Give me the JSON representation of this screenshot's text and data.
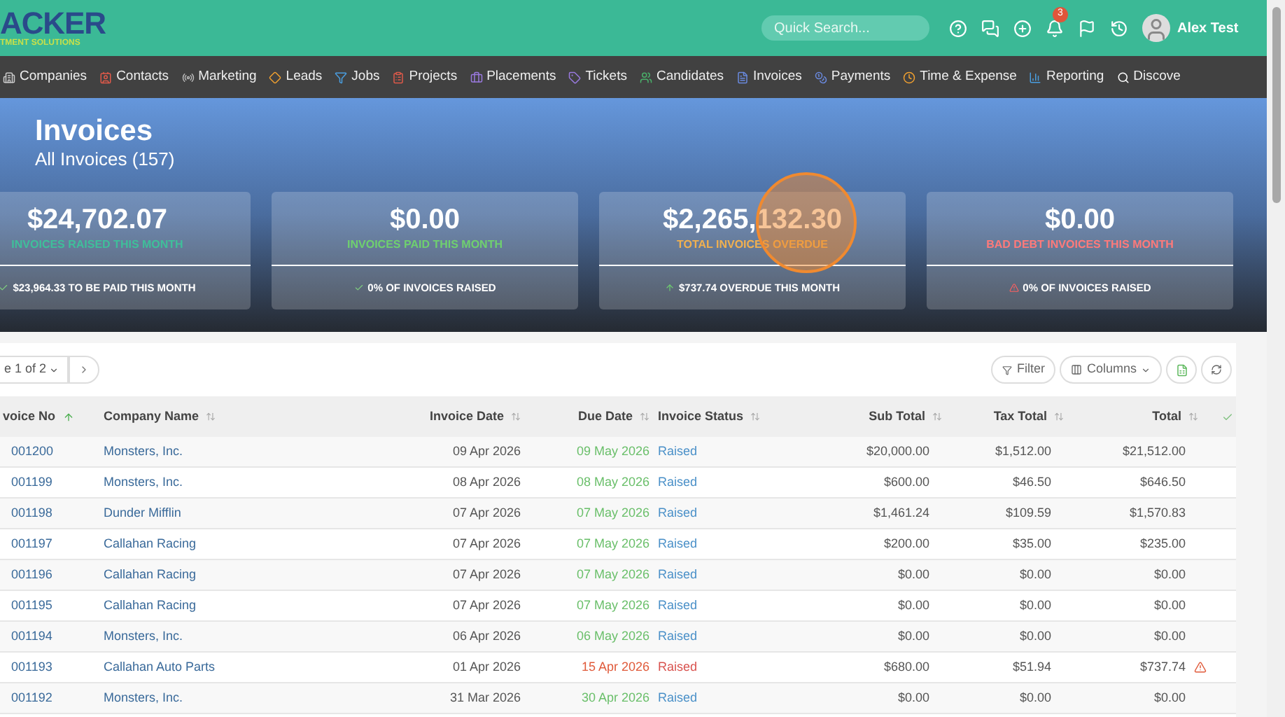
{
  "brand": {
    "name": "ACKER",
    "tagline": "TMENT SOLUTIONS"
  },
  "search": {
    "placeholder": "Quick Search..."
  },
  "notifications": {
    "count": "3"
  },
  "user": {
    "name": "Alex Test"
  },
  "nav": [
    {
      "label": "Companies"
    },
    {
      "label": "Contacts"
    },
    {
      "label": "Marketing"
    },
    {
      "label": "Leads"
    },
    {
      "label": "Jobs"
    },
    {
      "label": "Projects"
    },
    {
      "label": "Placements"
    },
    {
      "label": "Tickets"
    },
    {
      "label": "Candidates"
    },
    {
      "label": "Invoices"
    },
    {
      "label": "Payments"
    },
    {
      "label": "Time & Expense"
    },
    {
      "label": "Reporting"
    },
    {
      "label": "Discove"
    }
  ],
  "page": {
    "title": "Invoices",
    "subtitle": "All Invoices (157)"
  },
  "stats": [
    {
      "value": "$24,702.07",
      "label": "INVOICES RAISED THIS MONTH",
      "footer": "$23,964.33 TO BE PAID THIS MONTH"
    },
    {
      "value": "$0.00",
      "label": "INVOICES PAID THIS MONTH",
      "footer": "0% OF INVOICES RAISED"
    },
    {
      "value": "$2,265,132.30",
      "label": "TOTAL INVOICES OVERDUE",
      "footer": "$737.74 OVERDUE THIS MONTH"
    },
    {
      "value": "$0.00",
      "label": "BAD DEBT INVOICES THIS MONTH",
      "footer": "0% OF INVOICES RAISED"
    }
  ],
  "pagination": {
    "page": "e 1 of 2"
  },
  "toolbar": {
    "filter": "Filter",
    "columns": "Columns"
  },
  "table": {
    "columns": [
      {
        "label": "voice No",
        "sorted": true
      },
      {
        "label": "Company Name",
        "sorted": false
      },
      {
        "label": "Invoice Date",
        "sorted": false
      },
      {
        "label": "Due Date",
        "sorted": false
      },
      {
        "label": "Invoice Status",
        "sorted": false
      },
      {
        "label": "Sub Total",
        "sorted": false
      },
      {
        "label": "Tax Total",
        "sorted": false
      },
      {
        "label": "Total",
        "sorted": false
      }
    ],
    "rows": [
      {
        "cells": [
          "001200",
          "Monsters, Inc.",
          "09 Apr 2026",
          "09 May 2026",
          "Raised",
          "$20,000.00",
          "$1,512.00",
          "$21,512.00"
        ],
        "overdue": false
      },
      {
        "cells": [
          "001199",
          "Monsters, Inc.",
          "08 Apr 2026",
          "08 May 2026",
          "Raised",
          "$600.00",
          "$46.50",
          "$646.50"
        ],
        "overdue": false
      },
      {
        "cells": [
          "001198",
          "Dunder Mifflin",
          "07 Apr 2026",
          "07 May 2026",
          "Raised",
          "$1,461.24",
          "$109.59",
          "$1,570.83"
        ],
        "overdue": false
      },
      {
        "cells": [
          "001197",
          "Callahan Racing",
          "07 Apr 2026",
          "07 May 2026",
          "Raised",
          "$200.00",
          "$35.00",
          "$235.00"
        ],
        "overdue": false
      },
      {
        "cells": [
          "001196",
          "Callahan Racing",
          "07 Apr 2026",
          "07 May 2026",
          "Raised",
          "$0.00",
          "$0.00",
          "$0.00"
        ],
        "overdue": false
      },
      {
        "cells": [
          "001195",
          "Callahan Racing",
          "07 Apr 2026",
          "07 May 2026",
          "Raised",
          "$0.00",
          "$0.00",
          "$0.00"
        ],
        "overdue": false
      },
      {
        "cells": [
          "001194",
          "Monsters, Inc.",
          "06 Apr 2026",
          "06 May 2026",
          "Raised",
          "$0.00",
          "$0.00",
          "$0.00"
        ],
        "overdue": false
      },
      {
        "cells": [
          "001193",
          "Callahan Auto Parts",
          "01 Apr 2026",
          "15 Apr 2026",
          "Raised",
          "$680.00",
          "$51.94",
          "$737.74"
        ],
        "overdue": true
      },
      {
        "cells": [
          "001192",
          "Monsters, Inc.",
          "31 Mar 2026",
          "30 Apr 2026",
          "Raised",
          "$0.00",
          "$0.00",
          "$0.00"
        ],
        "overdue": false
      }
    ]
  }
}
